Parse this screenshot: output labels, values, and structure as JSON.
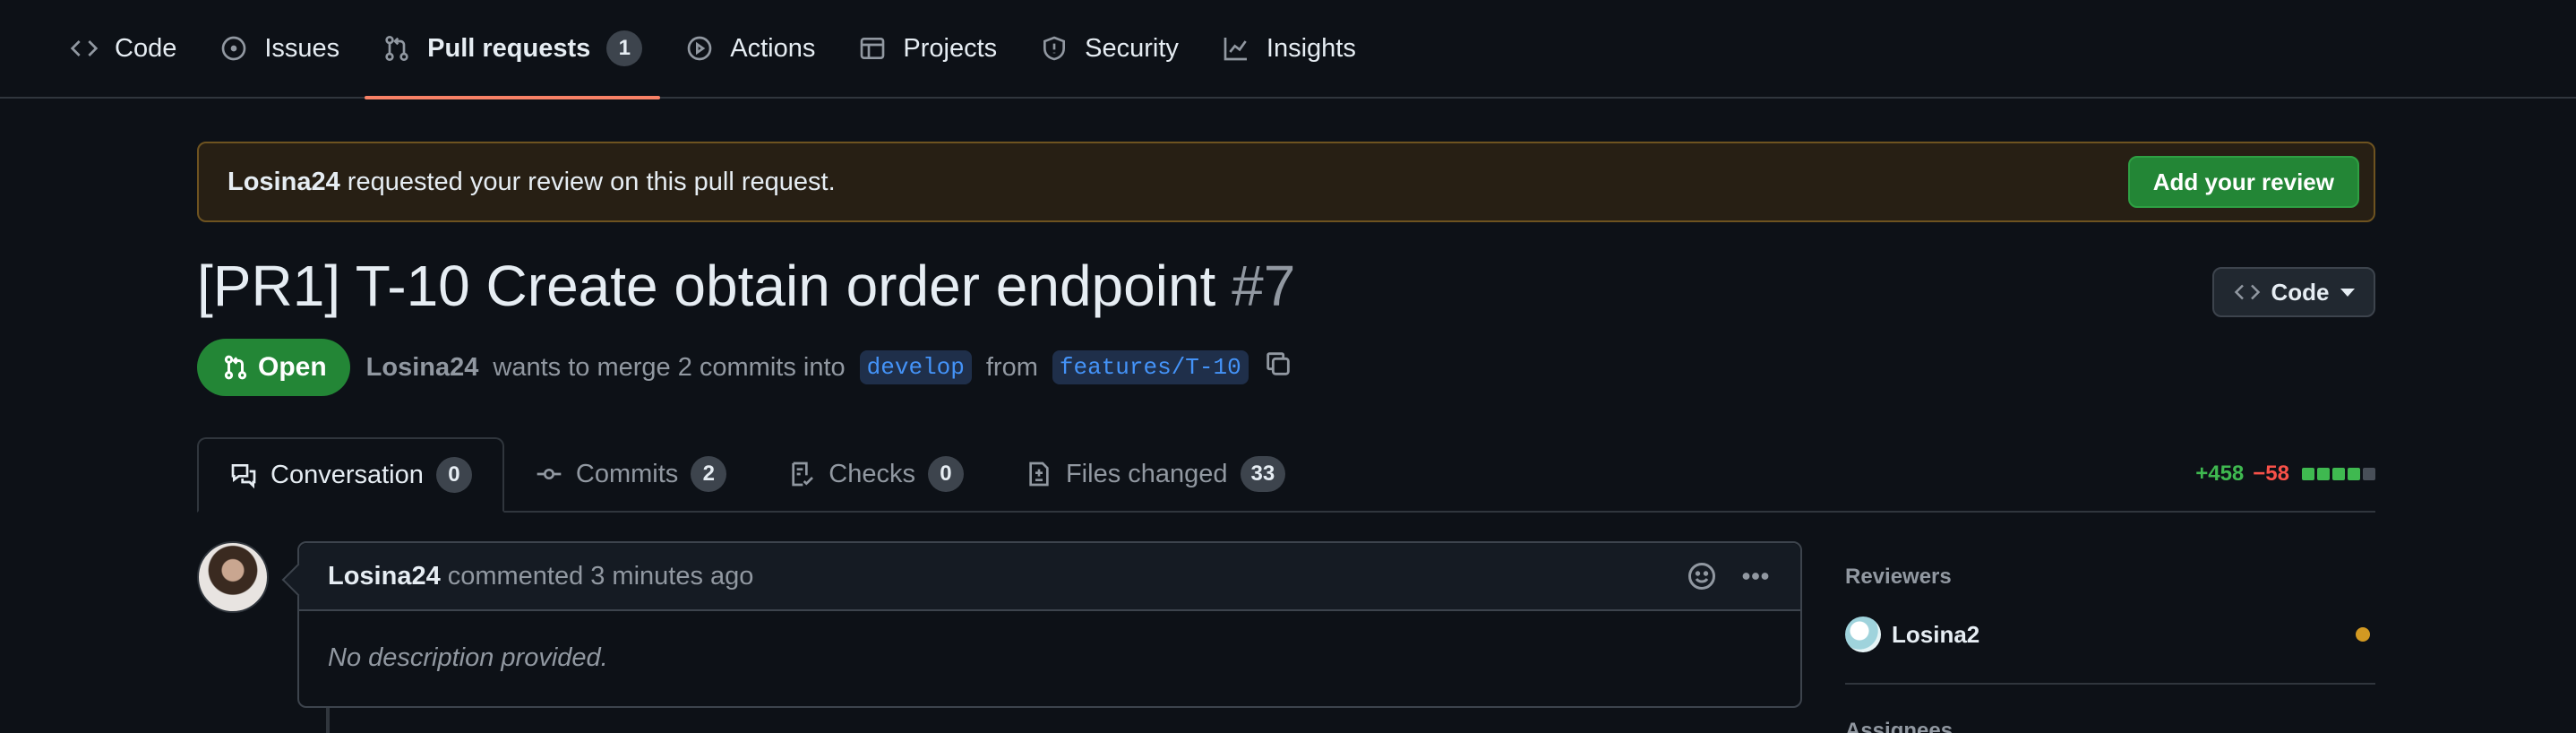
{
  "repo_nav": {
    "items": [
      {
        "label": "Code",
        "icon": "code-icon"
      },
      {
        "label": "Issues",
        "icon": "issue-opened-icon"
      },
      {
        "label": "Pull requests",
        "icon": "git-pull-request-icon",
        "count": "1",
        "active": true
      },
      {
        "label": "Actions",
        "icon": "play-icon"
      },
      {
        "label": "Projects",
        "icon": "table-icon"
      },
      {
        "label": "Security",
        "icon": "shield-icon"
      },
      {
        "label": "Insights",
        "icon": "graph-icon"
      }
    ]
  },
  "banner": {
    "user": "Losina24",
    "text": "requested your review on this pull request.",
    "button_label": "Add your review"
  },
  "pr": {
    "title": "[PR1] T-10 Create obtain order endpoint",
    "number": "#7",
    "code_button_label": "Code",
    "state": "Open",
    "author": "Losina24",
    "merge_text": "wants to merge 2 commits into",
    "base_branch": "develop",
    "from_text": "from",
    "head_branch": "features/T-10"
  },
  "tabs": [
    {
      "label": "Conversation",
      "count": "0",
      "icon": "comment-discussion-icon",
      "active": true
    },
    {
      "label": "Commits",
      "count": "2",
      "icon": "git-commit-icon"
    },
    {
      "label": "Checks",
      "count": "0",
      "icon": "checklist-icon"
    },
    {
      "label": "Files changed",
      "count": "33",
      "icon": "file-diff-icon"
    }
  ],
  "diffstat": {
    "additions": "+458",
    "deletions": "−58",
    "blocks": [
      "#3fb950",
      "#3fb950",
      "#3fb950",
      "#3fb950",
      "#484f58"
    ]
  },
  "comment": {
    "author": "Losina24",
    "action": "commented",
    "time": "3 minutes ago",
    "body": "No description provided."
  },
  "sidebar": {
    "reviewers_heading": "Reviewers",
    "reviewer_name": "Losina2",
    "assignees_heading": "Assignees"
  },
  "colors": {
    "accent_underline": "#f78166",
    "open_green": "#238636",
    "pending": "#d29922"
  }
}
